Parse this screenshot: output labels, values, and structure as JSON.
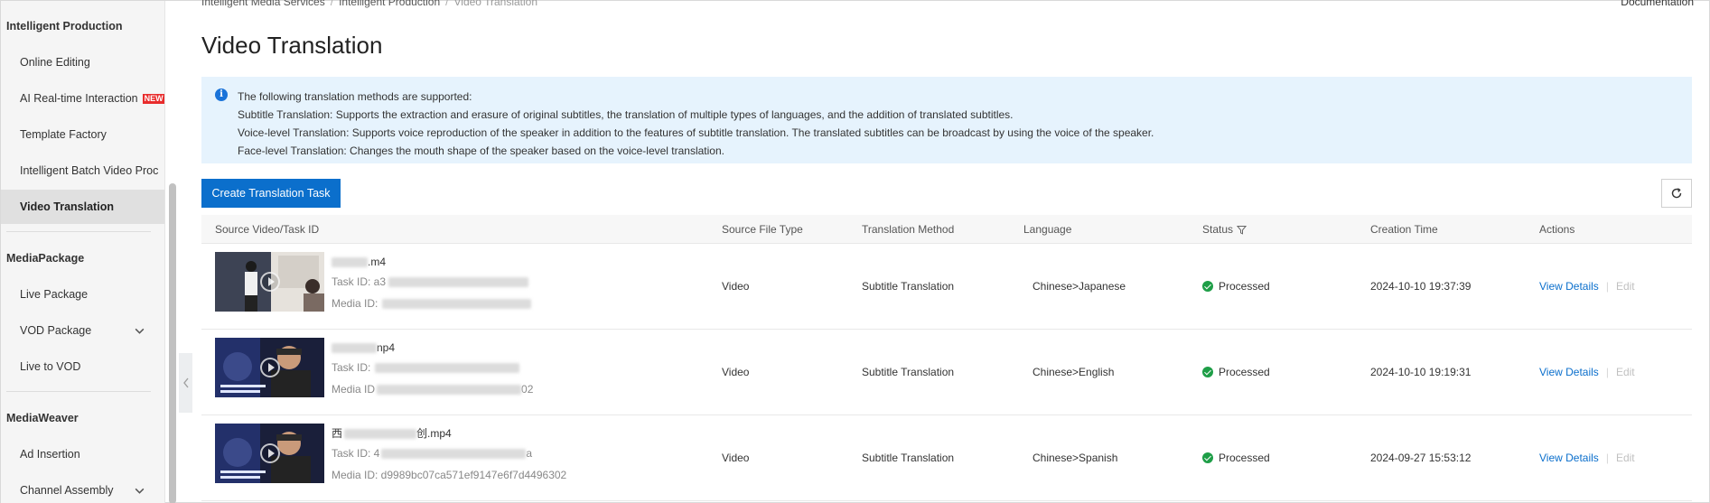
{
  "sidebar": {
    "groups": [
      {
        "title": "Intelligent Production"
      },
      {
        "title": "MediaPackage"
      },
      {
        "title": "MediaWeaver"
      }
    ],
    "items": [
      {
        "label": "Online Editing"
      },
      {
        "label": "AI Real-time Interaction",
        "badge": "NEW"
      },
      {
        "label": "Template Factory"
      },
      {
        "label": "Intelligent Batch Video Proc"
      },
      {
        "label": "Video Translation"
      },
      {
        "label": "Live Package"
      },
      {
        "label": "VOD Package"
      },
      {
        "label": "Live to VOD"
      },
      {
        "label": "Ad Insertion"
      },
      {
        "label": "Channel Assembly"
      }
    ],
    "collapse_icon": "chevron-left-icon"
  },
  "breadcrumb": [
    "Intelligent Media Services",
    "Intelligent Production",
    "Video Translation"
  ],
  "documentation_link": "Documentation",
  "page_title": "Video Translation",
  "notice": {
    "icon": "info-icon",
    "lines": [
      "The following translation methods are supported:",
      "Subtitle Translation: Supports the extraction and erasure of original subtitles, the translation of multiple types of languages, and the addition of translated subtitles.",
      "Voice-level Translation: Supports voice reproduction of the speaker in addition to the features of subtitle translation. The translated subtitles can be broadcast by using the voice of the speaker.",
      "Face-level Translation: Changes the mouth shape of the speaker based on the voice-level translation."
    ]
  },
  "create_button": "Create Translation Task",
  "refresh_icon": "refresh-icon",
  "table": {
    "columns": [
      "Source Video/Task ID",
      "Source File Type",
      "Translation Method",
      "Language",
      "Status",
      "Creation Time",
      "Actions"
    ],
    "status_filter_icon": "filter-icon",
    "rows": [
      {
        "file_name": ".m4",
        "task_id_label": "Task ID: a3",
        "media_id_label": "Media ID:",
        "file_type": "Video",
        "method": "Subtitle Translation",
        "language": "Chinese>Japanese",
        "status": "Processed",
        "created": "2024-10-10 19:37:39",
        "action_view": "View Details",
        "action_edit": "Edit"
      },
      {
        "file_name": "np4",
        "task_id_label": "Task ID:",
        "media_id_label": "Media ID",
        "media_id_tail": "02",
        "file_type": "Video",
        "method": "Subtitle Translation",
        "language": "Chinese>English",
        "status": "Processed",
        "created": "2024-10-10 19:19:31",
        "action_view": "View Details",
        "action_edit": "Edit"
      },
      {
        "file_name_prefix": "西",
        "file_name": "创.mp4",
        "task_id_label": "Task ID: 4",
        "task_id_tail": "a",
        "media_id_label": "Media ID: d9989bc07ca571ef9147e6f7d4496302",
        "file_type": "Video",
        "method": "Subtitle Translation",
        "language": "Chinese>Spanish",
        "status": "Processed",
        "created": "2024-09-27 15:53:12",
        "action_view": "View Details",
        "action_edit": "Edit"
      }
    ]
  },
  "colors": {
    "accent": "#0b6fcc",
    "success": "#1e9e47",
    "notice_bg": "#e6f3fd"
  }
}
